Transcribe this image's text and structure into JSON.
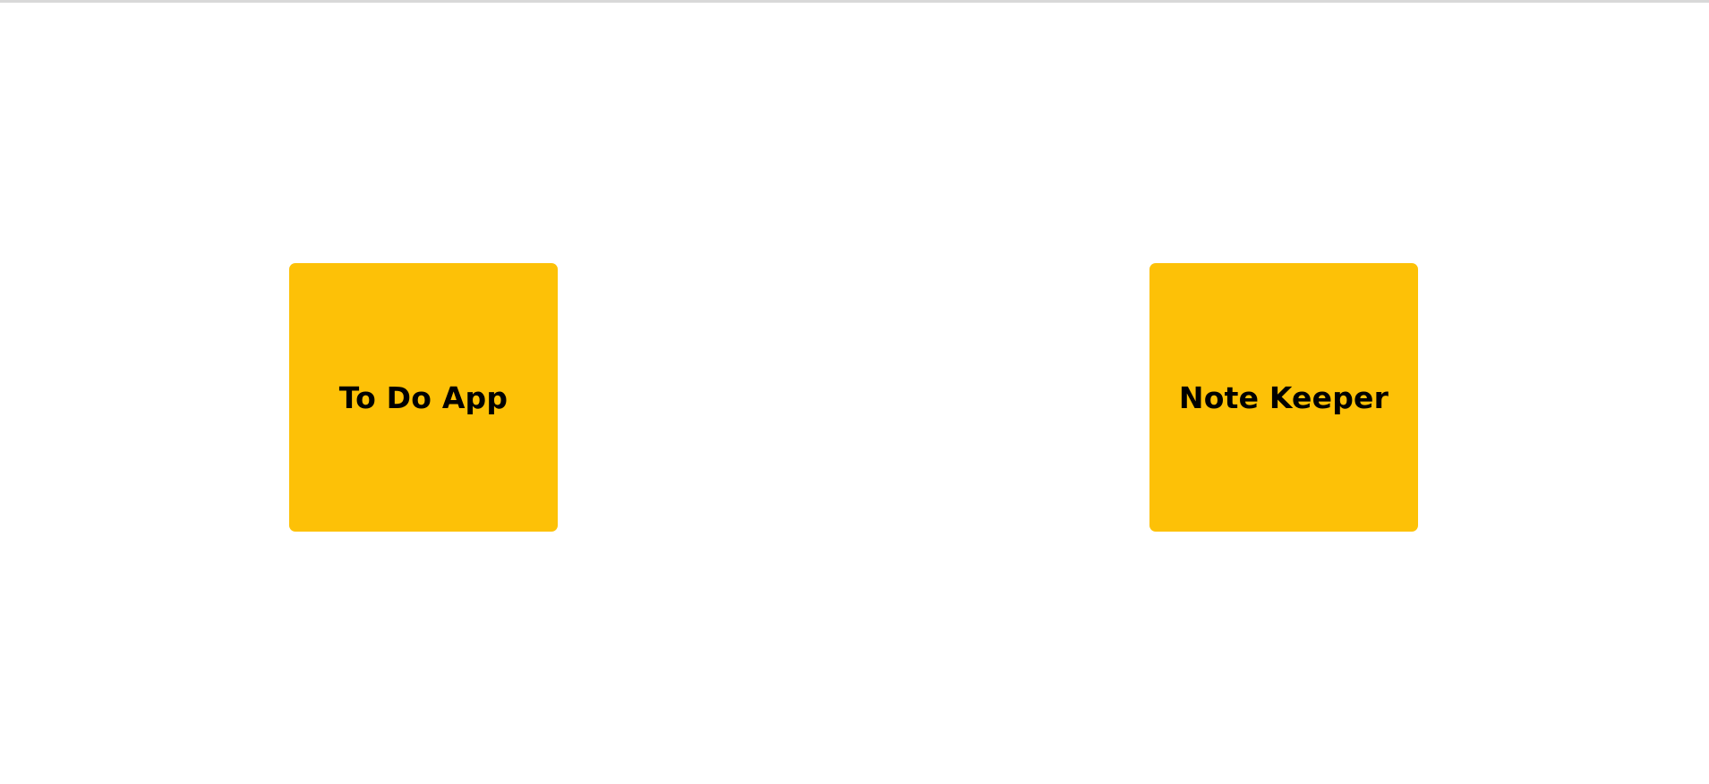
{
  "colors": {
    "card_background": "#fdc107",
    "card_text": "#000000",
    "page_background": "#ffffff",
    "top_border": "#d8d8d8"
  },
  "apps": [
    {
      "label": "To Do App"
    },
    {
      "label": "Note Keeper"
    }
  ]
}
